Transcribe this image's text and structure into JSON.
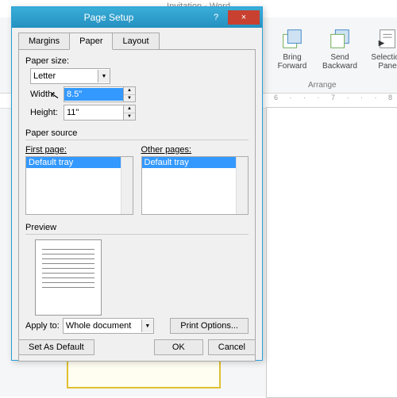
{
  "app_title": "Invitation - Word",
  "ribbon": {
    "bring_forward": "Bring\nForward",
    "send_backward": "Send\nBackward",
    "selection_pane": "Selection\nPane",
    "arrange": "Arrange"
  },
  "dialog": {
    "title": "Page Setup",
    "help": "?",
    "close": "×",
    "tabs": {
      "margins": "Margins",
      "paper": "Paper",
      "layout": "Layout"
    },
    "paper_size_label": "Paper size:",
    "paper_size_value": "Letter",
    "width_label": "Width:",
    "width_value": "8.5\"",
    "height_label": "Height:",
    "height_value": "11\"",
    "paper_source_label": "Paper source",
    "first_page_label": "First page:",
    "other_pages_label": "Other pages:",
    "tray_item": "Default tray",
    "preview_label": "Preview",
    "apply_to_label": "Apply to:",
    "apply_to_value": "Whole document",
    "print_options": "Print Options...",
    "set_as_default": "Set As Default",
    "ok": "OK",
    "cancel": "Cancel"
  }
}
